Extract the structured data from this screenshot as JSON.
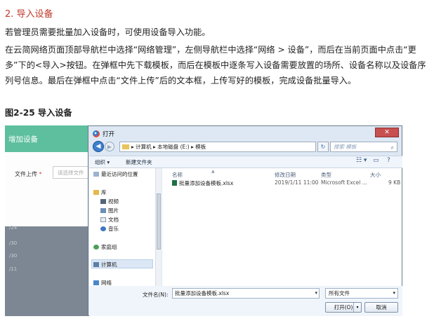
{
  "section": {
    "heading": "2. 导入设备"
  },
  "paragraphs": [
    "若管理员需要批量加入设备时，可使用设备导入功能。",
    "在云简网络页面顶部导航栏中选择“网络管理”，左侧导航栏中选择“网络 > 设备”，而后在当前页面中点击“更多”下的<导入>按钮。在弹框中先下载模板，而后在模板中逐条写入设备需要放置的场所、设备名称以及设备序列号信息。最后在弹框中点击“文件上传”后的文本框，上传写好的模板，完成设备批量导入。"
  ],
  "figure": {
    "caption": "图2-25 导入设备",
    "background_dialog": {
      "title": "增加设备",
      "field_label": "文件上传",
      "required_mark": "*",
      "input_placeholder": "请选择文件",
      "rows": [
        "/24",
        "/30",
        "/30",
        "/11"
      ]
    },
    "open_dialog": {
      "title": "打开",
      "close_glyph": "✕",
      "breadcrumb": "▸ 计算机 ▸ 本地磁盘 (E:) ▸ 模板",
      "search_placeholder": "搜索 模板",
      "toolbar": {
        "organize": "组织 ▾",
        "new_folder": "新建文件夹"
      },
      "nav_items": [
        "最近访问的位置",
        "库",
        "视频",
        "图片",
        "文档",
        "音乐",
        "家庭组",
        "计算机",
        "网络"
      ],
      "columns": {
        "name": "名称",
        "modified": "修改日期",
        "type": "类型",
        "size": "大小"
      },
      "files": [
        {
          "name": "批量添加设备模板.xlsx",
          "modified": "2019/1/11 11:00",
          "type": "Microsoft Excel ...",
          "size": "9 KB"
        }
      ],
      "filename_label": "文件名(N):",
      "filename_value": "批量添加设备模板.xlsx",
      "filetype_value": "所有文件",
      "open_button": "打开(O)",
      "cancel_button": "取消"
    }
  },
  "colors": {
    "heading": "#c0392b",
    "header_green": "#5dbf9e",
    "dialog_bg": "#dde8f4"
  }
}
